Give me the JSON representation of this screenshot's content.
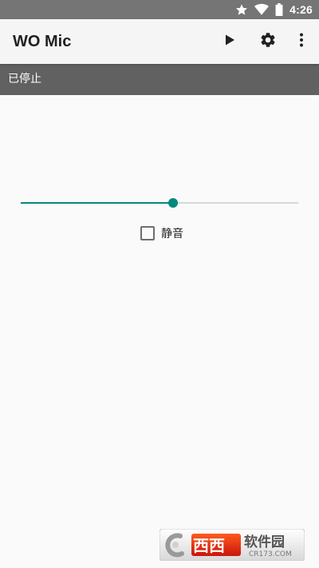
{
  "status_bar": {
    "time": "4:26",
    "icons": [
      "star-icon",
      "wifi-icon",
      "battery-icon"
    ]
  },
  "app_bar": {
    "title": "WO Mic",
    "actions": [
      "play-icon",
      "settings-icon",
      "more-vert-icon"
    ]
  },
  "state": {
    "text": "已停止"
  },
  "volume": {
    "value": 0.55
  },
  "mute": {
    "label": "静音",
    "checked": false
  },
  "watermark": {
    "text": "西西软件园",
    "sub": "CR173.COM"
  },
  "colors": {
    "accent": "#00897b",
    "status_bar": "#757575",
    "app_bar": "#f5f5f5",
    "state_strip": "#616161",
    "background": "#fafafa"
  }
}
